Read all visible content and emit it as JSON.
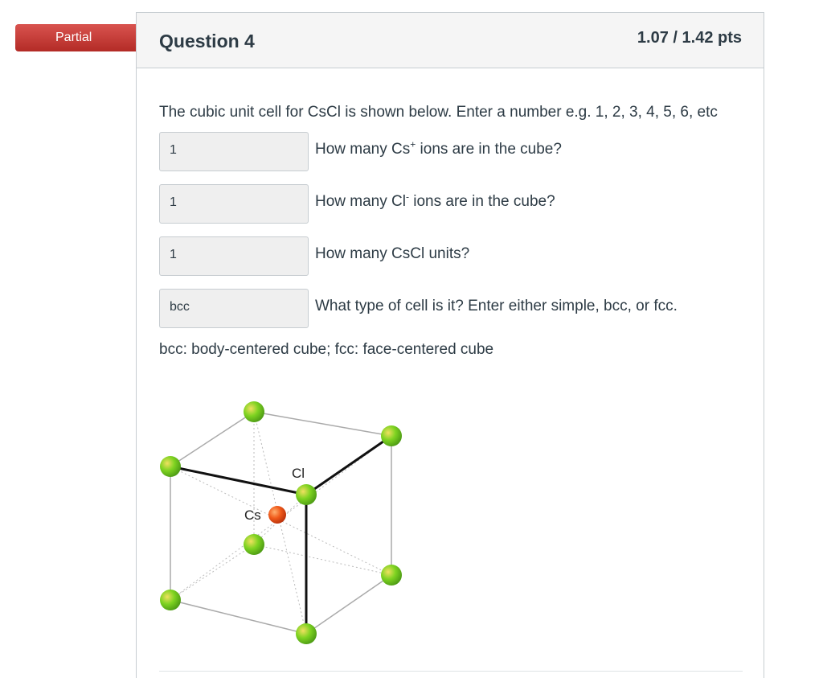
{
  "status_badge": "Partial",
  "question": {
    "title": "Question 4",
    "points": "1.07 / 1.42 pts",
    "intro": "The cubic unit cell for CsCl is shown below.  Enter a number e.g. 1, 2, 3, 4, 5, 6, etc",
    "items": [
      {
        "answer": "1",
        "prompt_before": "How many Cs",
        "prompt_sup": "+",
        "prompt_after": " ions are in the cube?"
      },
      {
        "answer": "1",
        "prompt_before": "How many Cl",
        "prompt_sup": "-",
        "prompt_after": " ions are in the cube?"
      },
      {
        "answer": "1",
        "prompt_before": "How many CsCl units?",
        "prompt_sup": "",
        "prompt_after": ""
      },
      {
        "answer": "bcc",
        "prompt_before": "What type of cell is it?  Enter either simple, bcc, or fcc.",
        "prompt_sup": "",
        "prompt_after": ""
      }
    ],
    "legend": "bcc: body-centered cube; fcc: face-centered cube"
  },
  "figure": {
    "label_cl": "Cl",
    "label_cs": "Cs",
    "cl_color": "#7ed321",
    "cs_color": "#f05a1a"
  }
}
